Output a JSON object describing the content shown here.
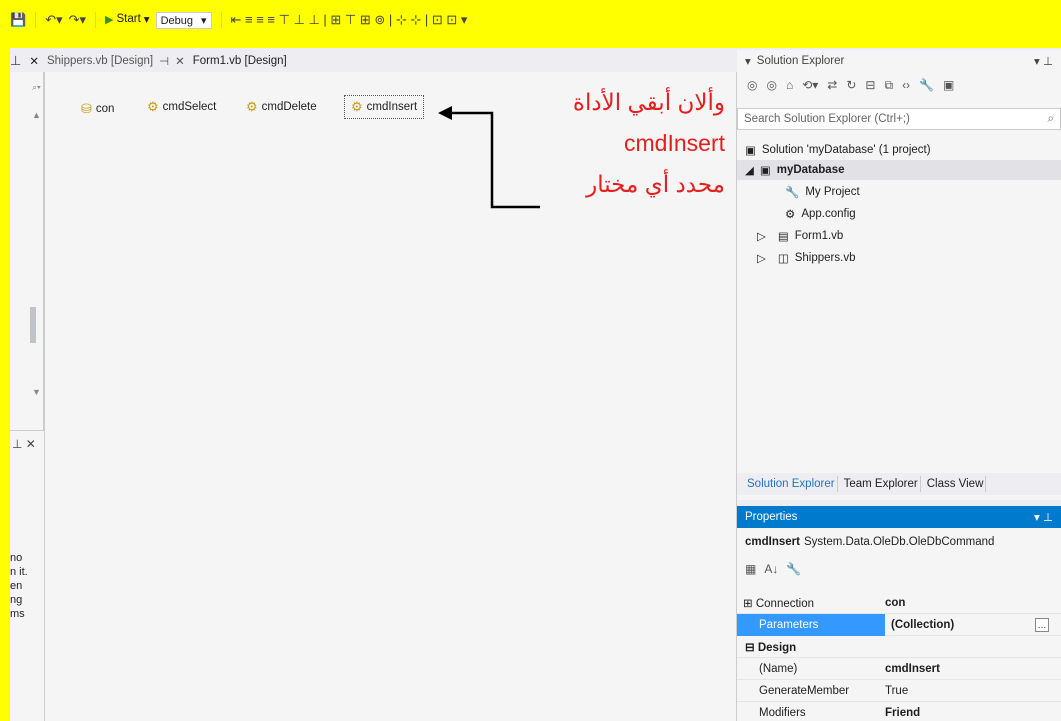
{
  "toolbar": {
    "start_label": "Start",
    "config_value": "Debug"
  },
  "tabs": [
    {
      "label": "Shippers.vb [Design]"
    },
    {
      "label": "Form1.vb [Design]"
    }
  ],
  "left_fragments": [
    "no",
    "n it.",
    "en",
    "ng",
    "ms"
  ],
  "components": [
    {
      "label": "con"
    },
    {
      "label": "cmdSelect"
    },
    {
      "label": "cmdDelete"
    },
    {
      "label": "cmdInsert"
    }
  ],
  "annotation": {
    "line1": "وألان أبقي الأداة",
    "line2": "cmdInsert",
    "line3": "محدد أي مختار"
  },
  "solution_explorer": {
    "title": "Solution Explorer",
    "search_placeholder": "Search Solution Explorer (Ctrl+;)",
    "solution": "Solution 'myDatabase' (1 project)",
    "project": "myDatabase",
    "items": [
      "My Project",
      "App.config",
      "Form1.vb",
      "Shippers.vb"
    ]
  },
  "bottom_tabs": [
    "Solution Explorer",
    "Team Explorer",
    "Class View"
  ],
  "properties": {
    "title": "Properties",
    "object_name": "cmdInsert",
    "object_type": "System.Data.OleDb.OleDbCommand",
    "rows": [
      {
        "name": "Connection",
        "value": "con"
      },
      {
        "name": "Parameters",
        "value": "(Collection)"
      },
      {
        "name": "Design",
        "value": ""
      },
      {
        "name": "(Name)",
        "value": "cmdInsert"
      },
      {
        "name": "GenerateMember",
        "value": "True"
      },
      {
        "name": "Modifiers",
        "value": "Friend"
      }
    ]
  }
}
